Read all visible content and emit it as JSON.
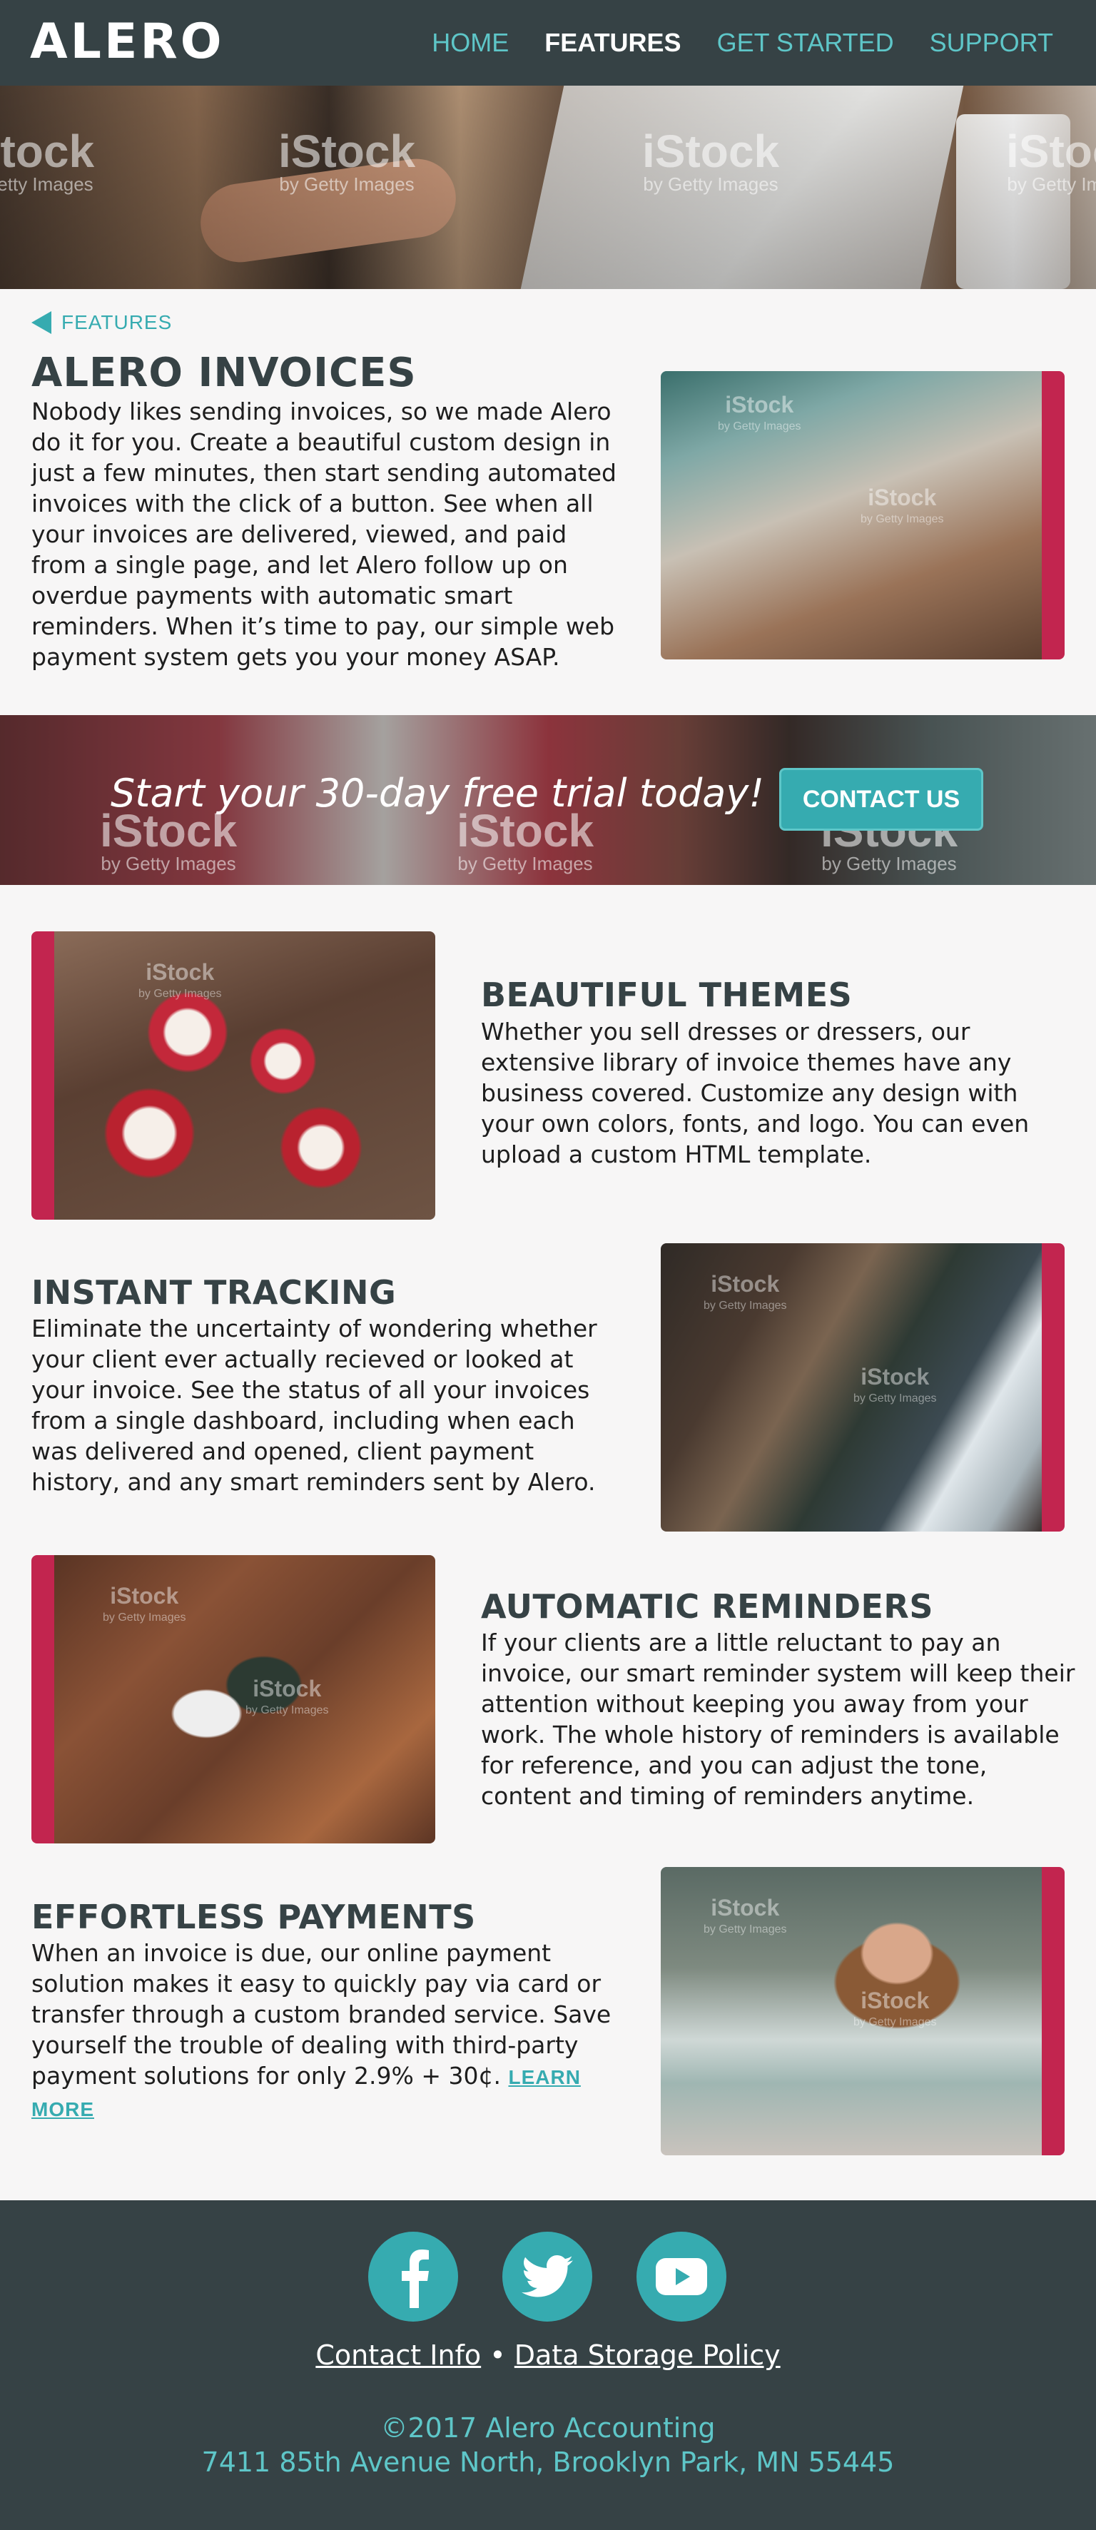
{
  "nav": {
    "logo": "ALERO",
    "links": [
      "HOME",
      "FEATURES",
      "GET STARTED",
      "SUPPORT"
    ],
    "active": "FEATURES"
  },
  "watermark": {
    "brand": "iStock",
    "sub": "by Getty Images"
  },
  "breadcrumb": {
    "label": "FEATURES",
    "icon": "back-triangle-icon"
  },
  "intro": {
    "title": "ALERO INVOICES",
    "body": "Nobody likes sending invoices, so we made Alero do it for you. Create a beautiful custom design in just a few minutes, then start sending automated invoices with the click of a button. See when all your invoices are delivered, viewed, and paid from a single page, and let Alero follow up on overdue payments with automatic smart reminders. When it’s time to pay, our simple web payment system gets you your money ASAP."
  },
  "cta": {
    "text": "Start your 30-day free trial today!",
    "button": "CONTACT US"
  },
  "features": [
    {
      "title": "BEAUTIFUL THEMES",
      "body": "Whether you sell dresses or dressers, our extensive library of invoice themes have any business covered. Customize any design with your own colors, fonts, and logo. You can even upload a custom HTML template."
    },
    {
      "title": "INSTANT TRACKING",
      "body": "Eliminate the uncertainty of wondering whether your client ever actually recieved or looked at your invoice. See the status of all your invoices from a single dashboard, including when each was delivered and opened, client payment history, and any smart reminders sent by Alero."
    },
    {
      "title": "AUTOMATIC REMINDERS",
      "body": "If your clients are a little reluctant to pay an invoice, our smart reminder system will keep their attention without keeping you away from your work. The whole history of reminders is available for reference, and you can adjust the tone, content and timing of reminders anytime."
    },
    {
      "title": "EFFORTLESS PAYMENTS",
      "body": "When an invoice is due, our online payment solution makes it easy to quickly pay via card or transfer through a custom branded service. Save yourself the trouble of dealing with third-party payment solutions for only 2.9% + 30¢.",
      "link": "LEARN MORE"
    }
  ],
  "footer": {
    "social": [
      "facebook-icon",
      "twitter-icon",
      "youtube-icon"
    ],
    "link1": "Contact Info",
    "separator": "•",
    "link2": "Data Storage Policy",
    "copyright": "©2017 Alero Accounting",
    "address": "7411 85th Avenue North, Brooklyn Park, MN 55445"
  },
  "colors": {
    "dark": "#364245",
    "accent": "#36abb0",
    "accent_light": "#5ec6c8",
    "bar": "#c2254f",
    "background": "#f7f6f6"
  }
}
